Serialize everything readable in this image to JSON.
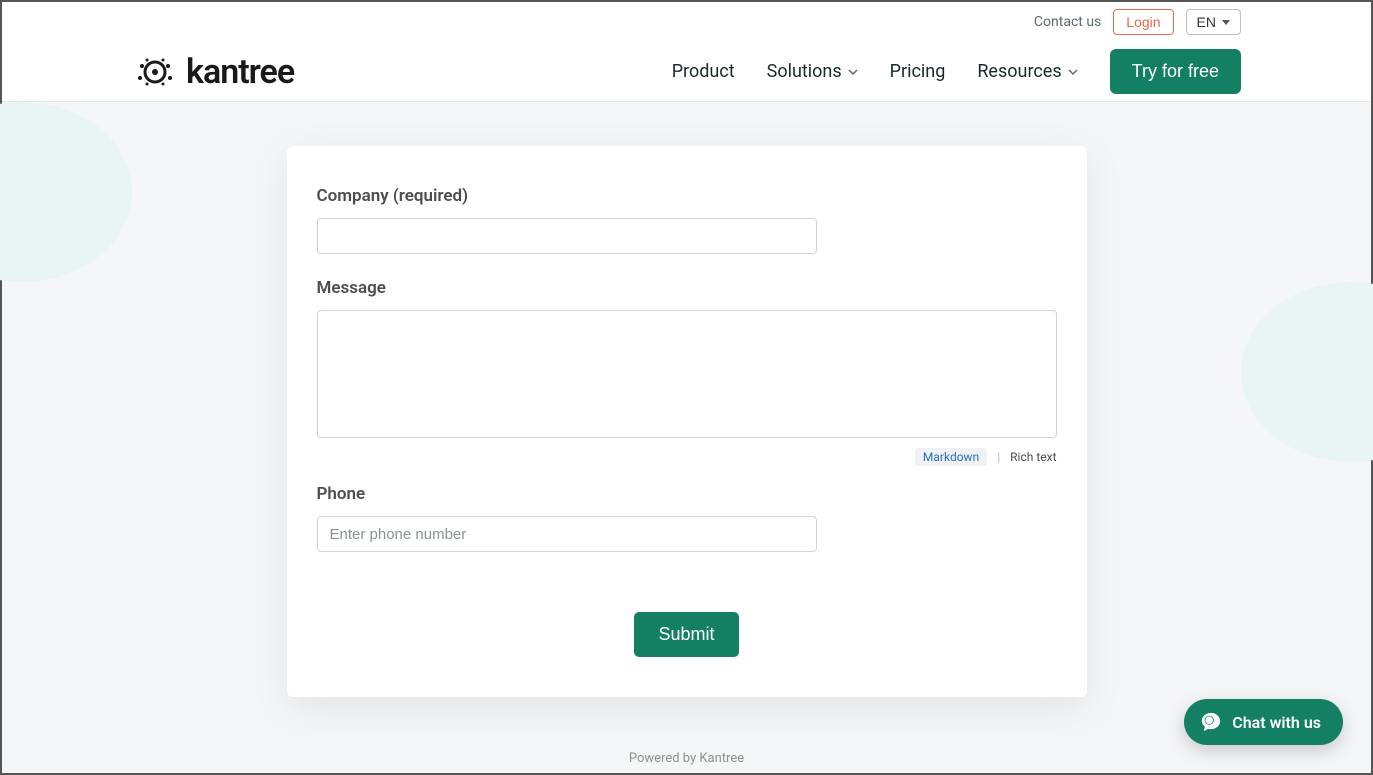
{
  "topbar": {
    "contact": "Contact us",
    "login": "Login",
    "lang": "EN"
  },
  "brand": {
    "name": "kantree"
  },
  "nav": {
    "product": "Product",
    "solutions": "Solutions",
    "pricing": "Pricing",
    "resources": "Resources",
    "cta": "Try for free"
  },
  "form": {
    "company_label": "Company (required)",
    "company_value": "",
    "message_label": "Message",
    "message_value": "",
    "markdown": "Markdown",
    "richtext": "Rich text",
    "phone_label": "Phone",
    "phone_placeholder": "Enter phone number",
    "phone_value": "",
    "submit": "Submit"
  },
  "footer": {
    "powered": "Powered by Kantree"
  },
  "chat": {
    "label": "Chat with us"
  }
}
